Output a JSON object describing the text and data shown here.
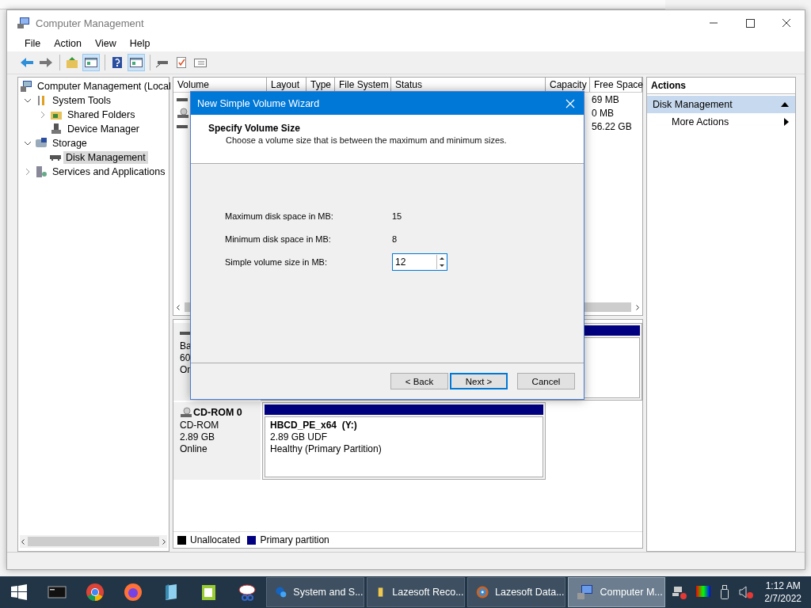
{
  "window": {
    "title": "Computer Management"
  },
  "menu": [
    {
      "label": "File"
    },
    {
      "label": "Action"
    },
    {
      "label": "View"
    },
    {
      "label": "Help"
    }
  ],
  "toolbar": [
    {
      "kind": "back"
    },
    {
      "kind": "forward"
    },
    {
      "kind": "sep"
    },
    {
      "kind": "up",
      "on": false
    },
    {
      "kind": "tree",
      "on": true
    },
    {
      "kind": "sep"
    },
    {
      "kind": "help",
      "on": false
    },
    {
      "kind": "pane",
      "on": true
    },
    {
      "kind": "sep"
    },
    {
      "kind": "connect",
      "on": false
    },
    {
      "kind": "check",
      "on": false
    },
    {
      "kind": "list",
      "on": false
    }
  ],
  "tree": [
    {
      "label": "Computer Management (Local",
      "kind": "computer",
      "selected": false,
      "children": [
        {
          "label": "System Tools",
          "kind": "tools",
          "expanded": true,
          "selected": false,
          "children": [
            {
              "label": "Shared Folders",
              "kind": "share",
              "expanded": false,
              "selected": false
            },
            {
              "label": "Device Manager",
              "kind": "device",
              "selected": false
            }
          ]
        },
        {
          "label": "Storage",
          "kind": "storage",
          "expanded": true,
          "selected": false,
          "children": [
            {
              "label": "Disk Management",
              "kind": "disk",
              "selected": true
            }
          ]
        },
        {
          "label": "Services and Applications",
          "kind": "services",
          "expanded": false,
          "selected": false
        }
      ]
    }
  ],
  "volume_list": {
    "columns": [
      "Volume",
      "Layout",
      "Type",
      "File System",
      "Status",
      "Capacity",
      "Free Space"
    ],
    "rows": [
      {
        "kind": "disk",
        "free_space": "69 MB"
      },
      {
        "kind": "cdrom",
        "free_space": "0 MB"
      },
      {
        "kind": "disk",
        "free_space": "56.22 GB"
      }
    ]
  },
  "disks": [
    {
      "kind": "disk",
      "lines": [
        "Ba",
        "60",
        "On"
      ]
    },
    {
      "kind": "cdrom",
      "name": "CD-ROM 0",
      "lines": [
        "CD-ROM",
        "2.89 GB",
        "Online"
      ],
      "partition": {
        "title": "HBCD_PE_x64  (Y:)",
        "lines": [
          "2.89 GB UDF",
          "Healthy (Primary Partition)"
        ]
      }
    }
  ],
  "legend": [
    {
      "label": "Unallocated",
      "color": "#000000"
    },
    {
      "label": "Primary partition",
      "color": "#000080"
    }
  ],
  "actions": {
    "title": "Actions",
    "items": [
      {
        "label": "Disk Management",
        "kind": "header",
        "expanded": true
      },
      {
        "label": "More Actions",
        "kind": "submenu"
      }
    ]
  },
  "dialog": {
    "title": "New Simple Volume Wizard",
    "heading": "Specify Volume Size",
    "subtitle": "Choose a volume size that is between the maximum and minimum sizes.",
    "fields": [
      {
        "label": "Maximum disk space in MB:",
        "value": "15",
        "kind": "text"
      },
      {
        "label": "Minimum disk space in MB:",
        "value": "8",
        "kind": "text"
      },
      {
        "label": "Simple volume size in MB:",
        "value": "12",
        "kind": "spin"
      }
    ],
    "buttons": [
      {
        "label": "< Back",
        "default": false
      },
      {
        "label": "Next >",
        "default": true
      },
      {
        "label": "Cancel",
        "default": false
      }
    ]
  },
  "taskbar": {
    "pinned": [
      {
        "kind": "terminal"
      },
      {
        "kind": "chrome"
      },
      {
        "kind": "firefox"
      },
      {
        "kind": "notepad"
      },
      {
        "kind": "notepadpp"
      },
      {
        "kind": "scissors"
      }
    ],
    "windows": [
      {
        "label": "System and S...",
        "kind": "blob",
        "selected": false
      },
      {
        "label": "Lazesoft Reco...",
        "kind": "folder",
        "selected": false
      },
      {
        "label": "Lazesoft Data...",
        "kind": "disc",
        "selected": false
      },
      {
        "label": "Computer M...",
        "kind": "computer",
        "selected": true
      }
    ],
    "time": "1:12 AM",
    "date": "2/7/2022"
  }
}
